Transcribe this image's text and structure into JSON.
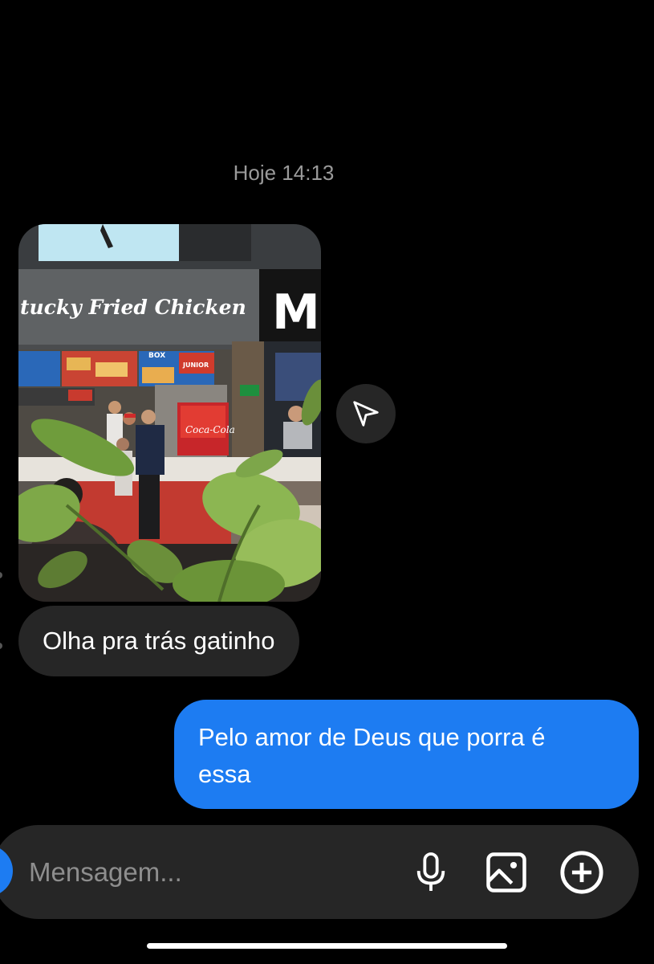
{
  "conversation": {
    "timestamp": "Hoje 14:13"
  },
  "messages": [
    {
      "type": "photo",
      "direction": "incoming",
      "visible_text": {
        "sign": "tucky Fried Chicken",
        "board_box": "BOX",
        "board_junior": "JUNIOR",
        "fridge_brand": "Coca-Cola",
        "partial_logo": "M"
      }
    },
    {
      "type": "text",
      "direction": "incoming",
      "text": "Olha pra trás gatinho"
    },
    {
      "type": "text",
      "direction": "outgoing",
      "text_line1": "Pelo amor de Deus que porra é",
      "text_line2": "essa"
    }
  ],
  "actions": {
    "share_icon": "paper-plane-icon"
  },
  "composer": {
    "placeholder": "Mensagem...",
    "icons": [
      "microphone-icon",
      "gallery-icon",
      "plus-circle-icon"
    ]
  },
  "colors": {
    "background": "#000000",
    "incoming_bubble": "#262626",
    "outgoing_bubble": "#1d7cf2",
    "timestamp": "#9a9a9a"
  }
}
